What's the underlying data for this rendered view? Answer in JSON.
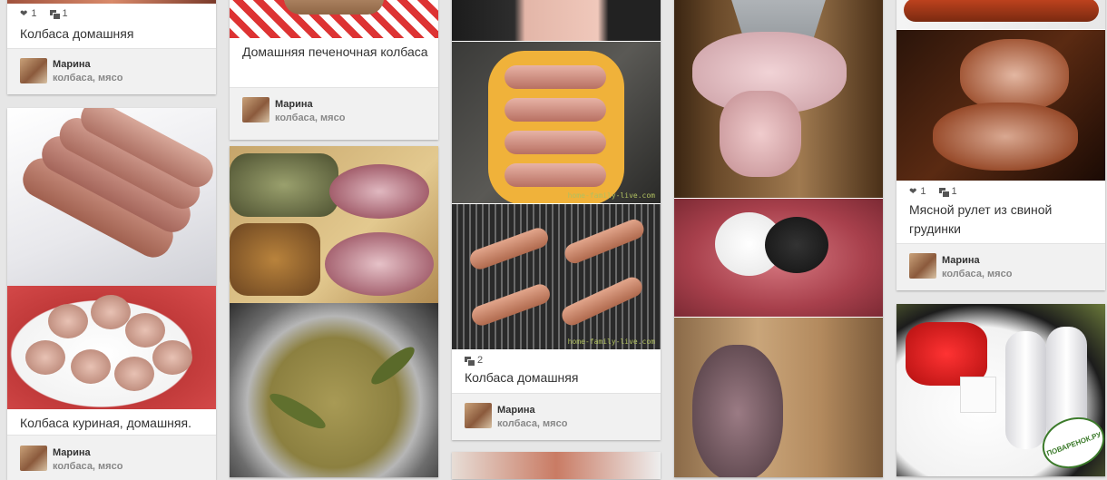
{
  "col1": {
    "card1": {
      "likes": "1",
      "reposts": "1",
      "title": "Колбаса домашняя",
      "author": "Марина",
      "tags": "колбаса, мясо"
    },
    "card2": {
      "title": "Колбаса куриная, домашняя.",
      "author": "Марина",
      "tags": "колбаса, мясо"
    }
  },
  "col2": {
    "card1": {
      "title": "Домашняя печеночная колбаса",
      "author": "Марина",
      "tags": "колбаса, мясо"
    }
  },
  "col3": {
    "card1": {
      "reposts": "2",
      "title": "Колбаса домашняя",
      "author": "Марина",
      "tags": "колбаса, мясо"
    },
    "watermark": "home-family-live.com"
  },
  "col5": {
    "card1": {
      "likes": "1",
      "reposts": "1",
      "title": "Мясной рулет из свиной грудинки",
      "author": "Марина",
      "tags": "колбаса, мясо"
    },
    "logo": "ПОВАРЕНОК.РУ"
  },
  "icons": {
    "like": "heart-icon",
    "repost": "repost-icon"
  }
}
